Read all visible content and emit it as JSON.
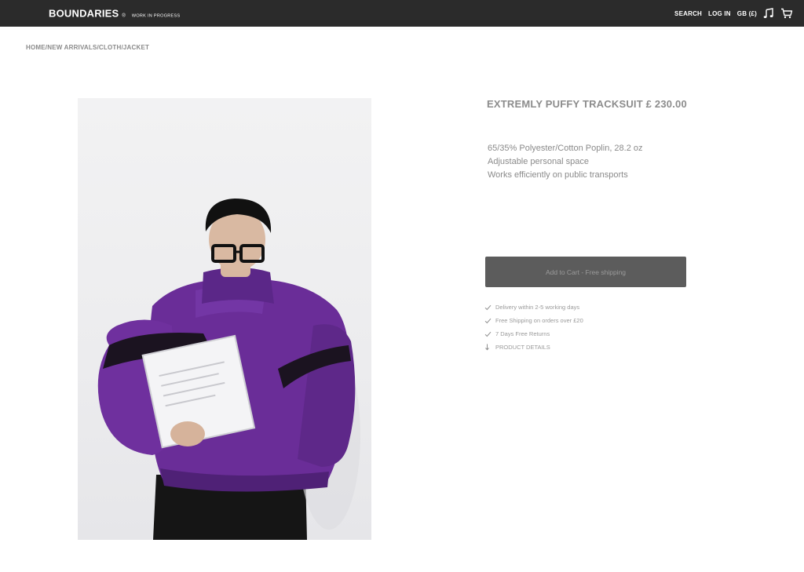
{
  "header": {
    "brand_name": "BOUNDARIES",
    "brand_registered": "®",
    "brand_tagline": "WORK IN PROGRESS",
    "nav": {
      "search": "SEARCH",
      "login": "LOG IN",
      "currency": "GB (£)"
    },
    "icons": [
      "music-icon",
      "cart-icon"
    ]
  },
  "breadcrumb": "HOME/NEW ARRIVALS/CLOTH/JACKET",
  "product": {
    "title": "EXTREMLY PUFFY TRACKSUIT £ 230.00",
    "features": [
      "65/35% Polyester/Cotton Poplin, 28.2 oz",
      "Adjustable personal space",
      "Works efficiently on public transports"
    ],
    "cta_label": "Add to Cart - Free shipping",
    "perks": [
      {
        "icon": "check-icon",
        "text": "Delivery within 2-5 working days"
      },
      {
        "icon": "check-icon",
        "text": "Free Shipping on orders over £20"
      },
      {
        "icon": "check-icon",
        "text": "7 Days Free Returns"
      },
      {
        "icon": "arrow-down-icon",
        "text": "PRODUCT DETAILS"
      }
    ]
  },
  "colors": {
    "topbar_bg": "#2b2b2b",
    "button_bg": "#5c5c5c",
    "jacket_purple": "#6a2d98"
  }
}
